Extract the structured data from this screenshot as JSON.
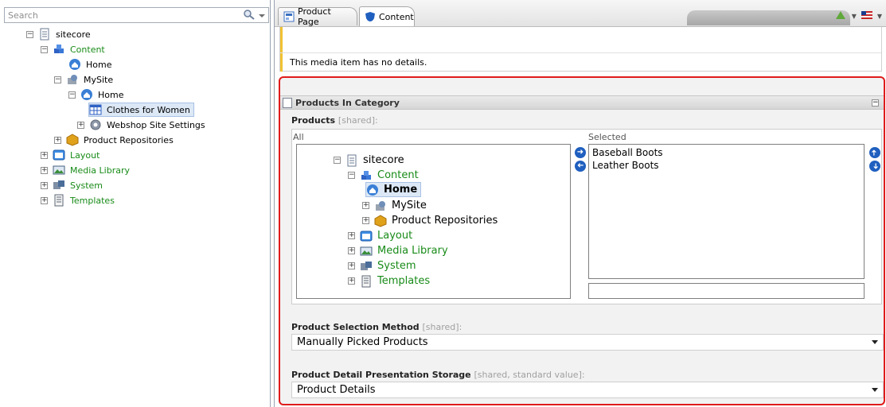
{
  "search": {
    "placeholder": "Search"
  },
  "content_tree": {
    "root": "sitecore",
    "content": "Content",
    "home": "Home",
    "mysite": "MySite",
    "mysite_home": "Home",
    "clothes_for_women": "Clothes for Women",
    "webshop_settings": "Webshop Site Settings",
    "product_repositories": "Product Repositories",
    "layout": "Layout",
    "media_library": "Media Library",
    "system": "System",
    "templates": "Templates"
  },
  "tabs": [
    {
      "label": "Product Page"
    },
    {
      "label": "Content"
    }
  ],
  "info": {
    "message": "This media item has no details."
  },
  "section": {
    "title": "Products In Category",
    "products_field": {
      "label": "Products",
      "shared": "[shared]:"
    },
    "all_caption": "All",
    "selected_caption": "Selected",
    "selected_items": [
      "Baseball Boots",
      "Leather Boots"
    ],
    "browse_tree": {
      "root": "sitecore",
      "content": "Content",
      "home": "Home",
      "mysite": "MySite",
      "product_repositories": "Product Repositories",
      "layout": "Layout",
      "media_library": "Media Library",
      "system": "System",
      "templates": "Templates"
    },
    "selection_method": {
      "label": "Product Selection Method",
      "shared": "[shared]:",
      "value": "Manually Picked Products"
    },
    "presentation_storage": {
      "label": "Product Detail Presentation Storage",
      "shared": "[shared, standard value]:",
      "value": "Product Details"
    }
  },
  "colors": {
    "accent_red": "#e01b1b",
    "green_text": "#188b18",
    "warning_bar": "#f1c232",
    "arrow_blue": "#1f5fbf"
  }
}
